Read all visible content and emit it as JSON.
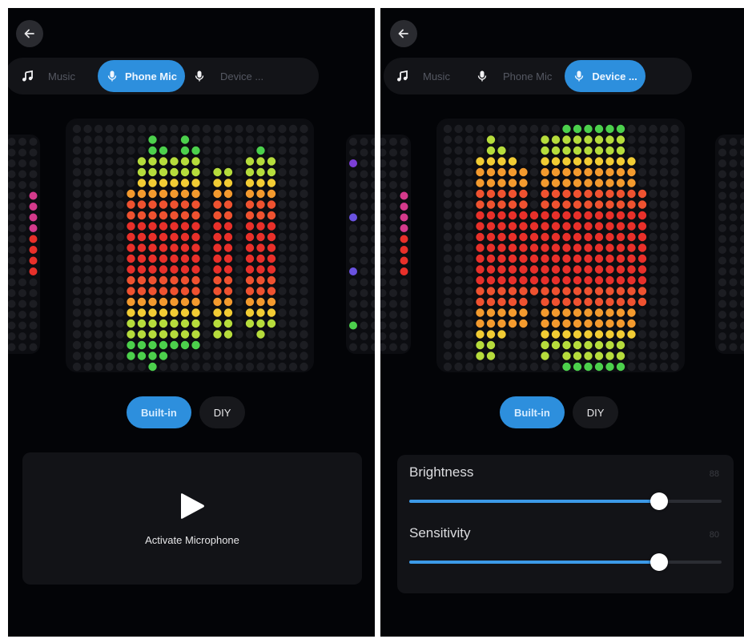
{
  "colors": {
    "accent": "#2d8fdd",
    "background": "#030407",
    "dot_off": "#1c1d22",
    "levels": [
      "#4cd04c",
      "#b6dc3c",
      "#f2cc34",
      "#f39a2e",
      "#ef5230",
      "#e8302a"
    ]
  },
  "icons": {
    "back": "arrow-left-icon",
    "music": "music-note-icon",
    "mic": "microphone-icon",
    "play": "play-icon"
  },
  "left_screen": {
    "tabs": [
      {
        "label": "Music",
        "active": false
      },
      {
        "label": "Phone Mic",
        "active": true
      },
      {
        "label": "Device ...",
        "active": false
      }
    ],
    "mode_buttons": [
      {
        "label": "Built-in",
        "active": true
      },
      {
        "label": "DIY",
        "active": false
      }
    ],
    "activate_label": "Activate Microphone",
    "equalizer": {
      "columns": 16,
      "rows": 16,
      "column_levels": [
        0,
        0,
        7,
        7,
        8,
        7,
        6,
        6,
        6,
        0,
        5,
        5,
        0,
        4,
        5,
        4
      ],
      "column_extent_top": [
        0,
        0,
        7,
        12,
        16,
        14,
        13,
        16,
        14,
        0,
        11,
        11,
        0,
        12,
        14,
        12
      ]
    }
  },
  "right_screen": {
    "tabs": [
      {
        "label": "Music",
        "active": false
      },
      {
        "label": "Phone Mic",
        "active": false
      },
      {
        "label": "Device ...",
        "active": true
      }
    ],
    "mode_buttons": [
      {
        "label": "Built-in",
        "active": true
      },
      {
        "label": "DIY",
        "active": false
      }
    ],
    "equalizer": {
      "columns": 16,
      "rows": 16,
      "column_extent_top": [
        9,
        12,
        10,
        9,
        8,
        3,
        11,
        12,
        14,
        15,
        16,
        14,
        15,
        13,
        9,
        6
      ],
      "column_extent_bottom": [
        11,
        12,
        9,
        8,
        8,
        4,
        11,
        10,
        14,
        15,
        16,
        14,
        15,
        13,
        9,
        6
      ]
    },
    "settings": {
      "brightness": {
        "label": "Brightness",
        "value": "88",
        "fraction": 0.8
      },
      "sensitivity": {
        "label": "Sensitivity",
        "value": "80",
        "fraction": 0.8
      }
    }
  }
}
